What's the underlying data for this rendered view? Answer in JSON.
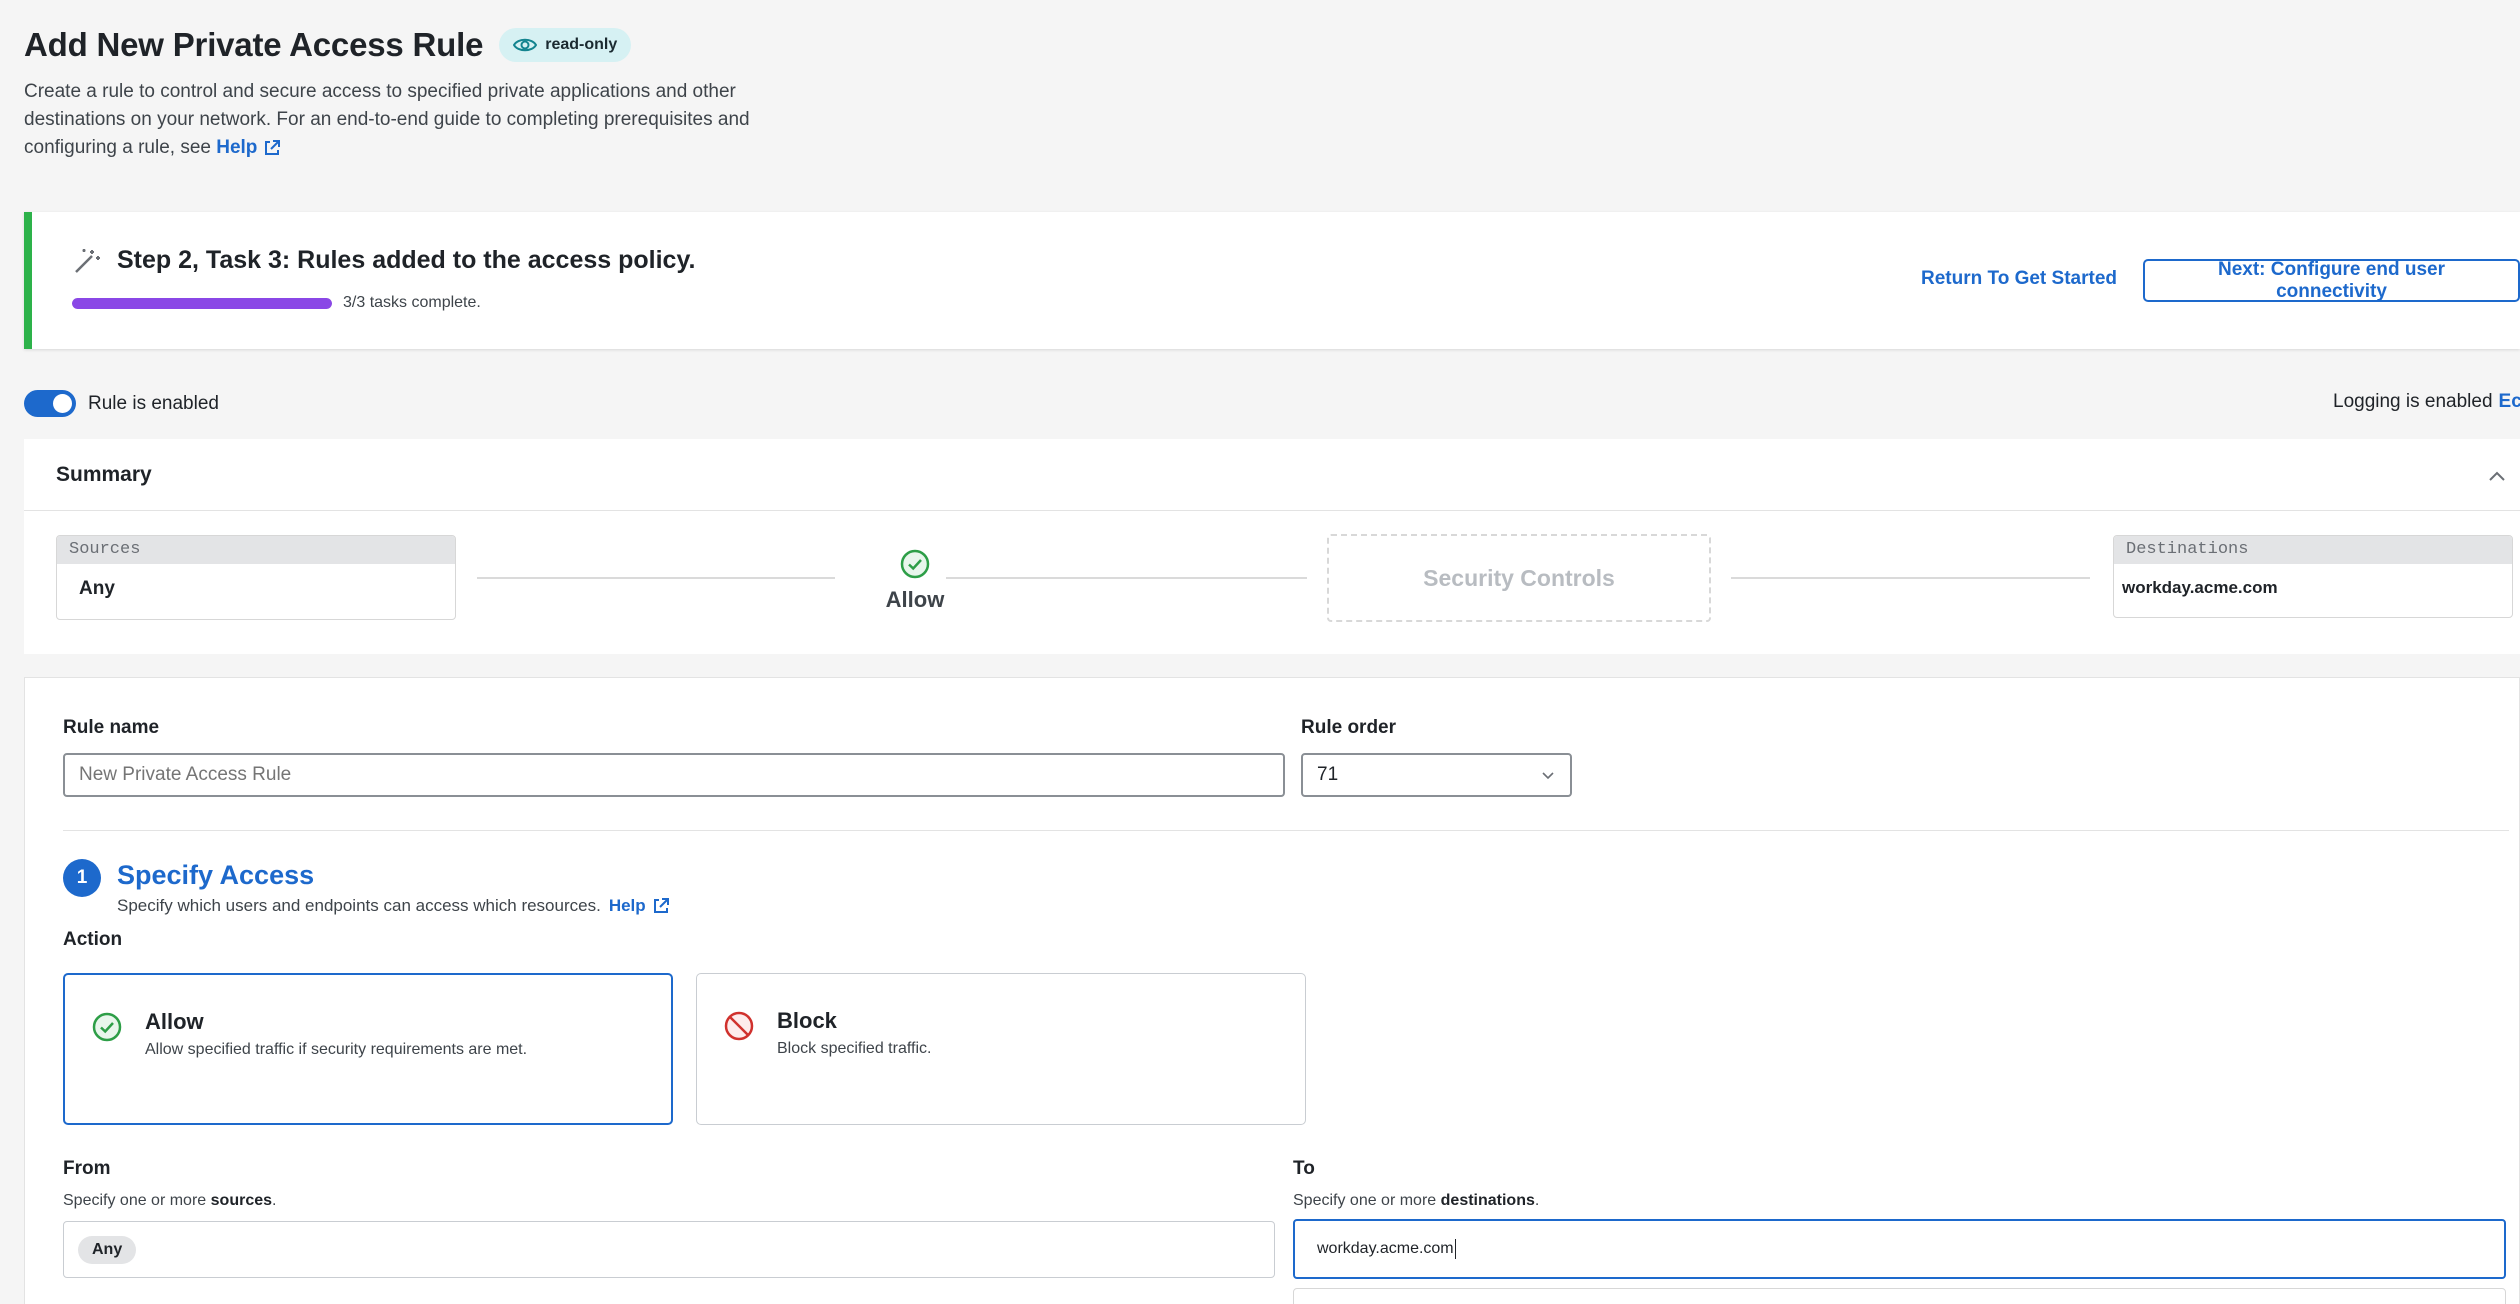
{
  "page": {
    "title": "Add New Private Access Rule",
    "badge": "read-only",
    "description": "Create a rule to control and secure access to specified private applications and other destinations on your network. For an end-to-end guide to completing prerequisites and configuring a rule, see",
    "help_link": "Help"
  },
  "task": {
    "title": "Step 2, Task 3: Rules added to the access policy.",
    "progress_text": "3/3 tasks complete.",
    "progress_fraction": 1.0,
    "return_link": "Return To Get Started",
    "next_button": "Next: Configure end user connectivity"
  },
  "toggle": {
    "label": "Rule is enabled",
    "enabled": true
  },
  "logging": {
    "text": "Logging is enabled",
    "edit_label": "Ec"
  },
  "summary": {
    "title": "Summary",
    "sources_header": "Sources",
    "sources_value": "Any",
    "action": "Allow",
    "security_controls": "Security Controls",
    "destinations_header": "Destinations",
    "destinations_value": "workday.acme.com"
  },
  "form": {
    "rule_name_label": "Rule name",
    "rule_name_placeholder": "New Private Access Rule",
    "rule_order_label": "Rule order",
    "rule_order_value": "71",
    "step_number": "1",
    "step_title": "Specify Access",
    "step_desc": "Specify which users and endpoints can access which resources.",
    "step_help": "Help",
    "action_label": "Action",
    "allow": {
      "title": "Allow",
      "desc": "Allow specified traffic if security requirements are met."
    },
    "block": {
      "title": "Block",
      "desc": "Block specified traffic."
    },
    "from_label": "From",
    "from_desc_prefix": "Specify one or more",
    "from_desc_bold": "sources",
    "from_chip": "Any",
    "to_label": "To",
    "to_desc_prefix": "Specify one or more",
    "to_desc_bold": "destinations",
    "to_value": "workday.acme.com"
  },
  "colors": {
    "accent": "#1d69cc",
    "success": "#2db24a",
    "progress": "#8a47e6",
    "badge_bg": "#d6f1f3",
    "block_red": "#d0312d"
  },
  "icons": [
    "eye-icon",
    "external-link-icon",
    "magic-wand-icon",
    "chevron-up-icon",
    "check-circle-icon",
    "chevron-down-icon",
    "block-icon"
  ]
}
